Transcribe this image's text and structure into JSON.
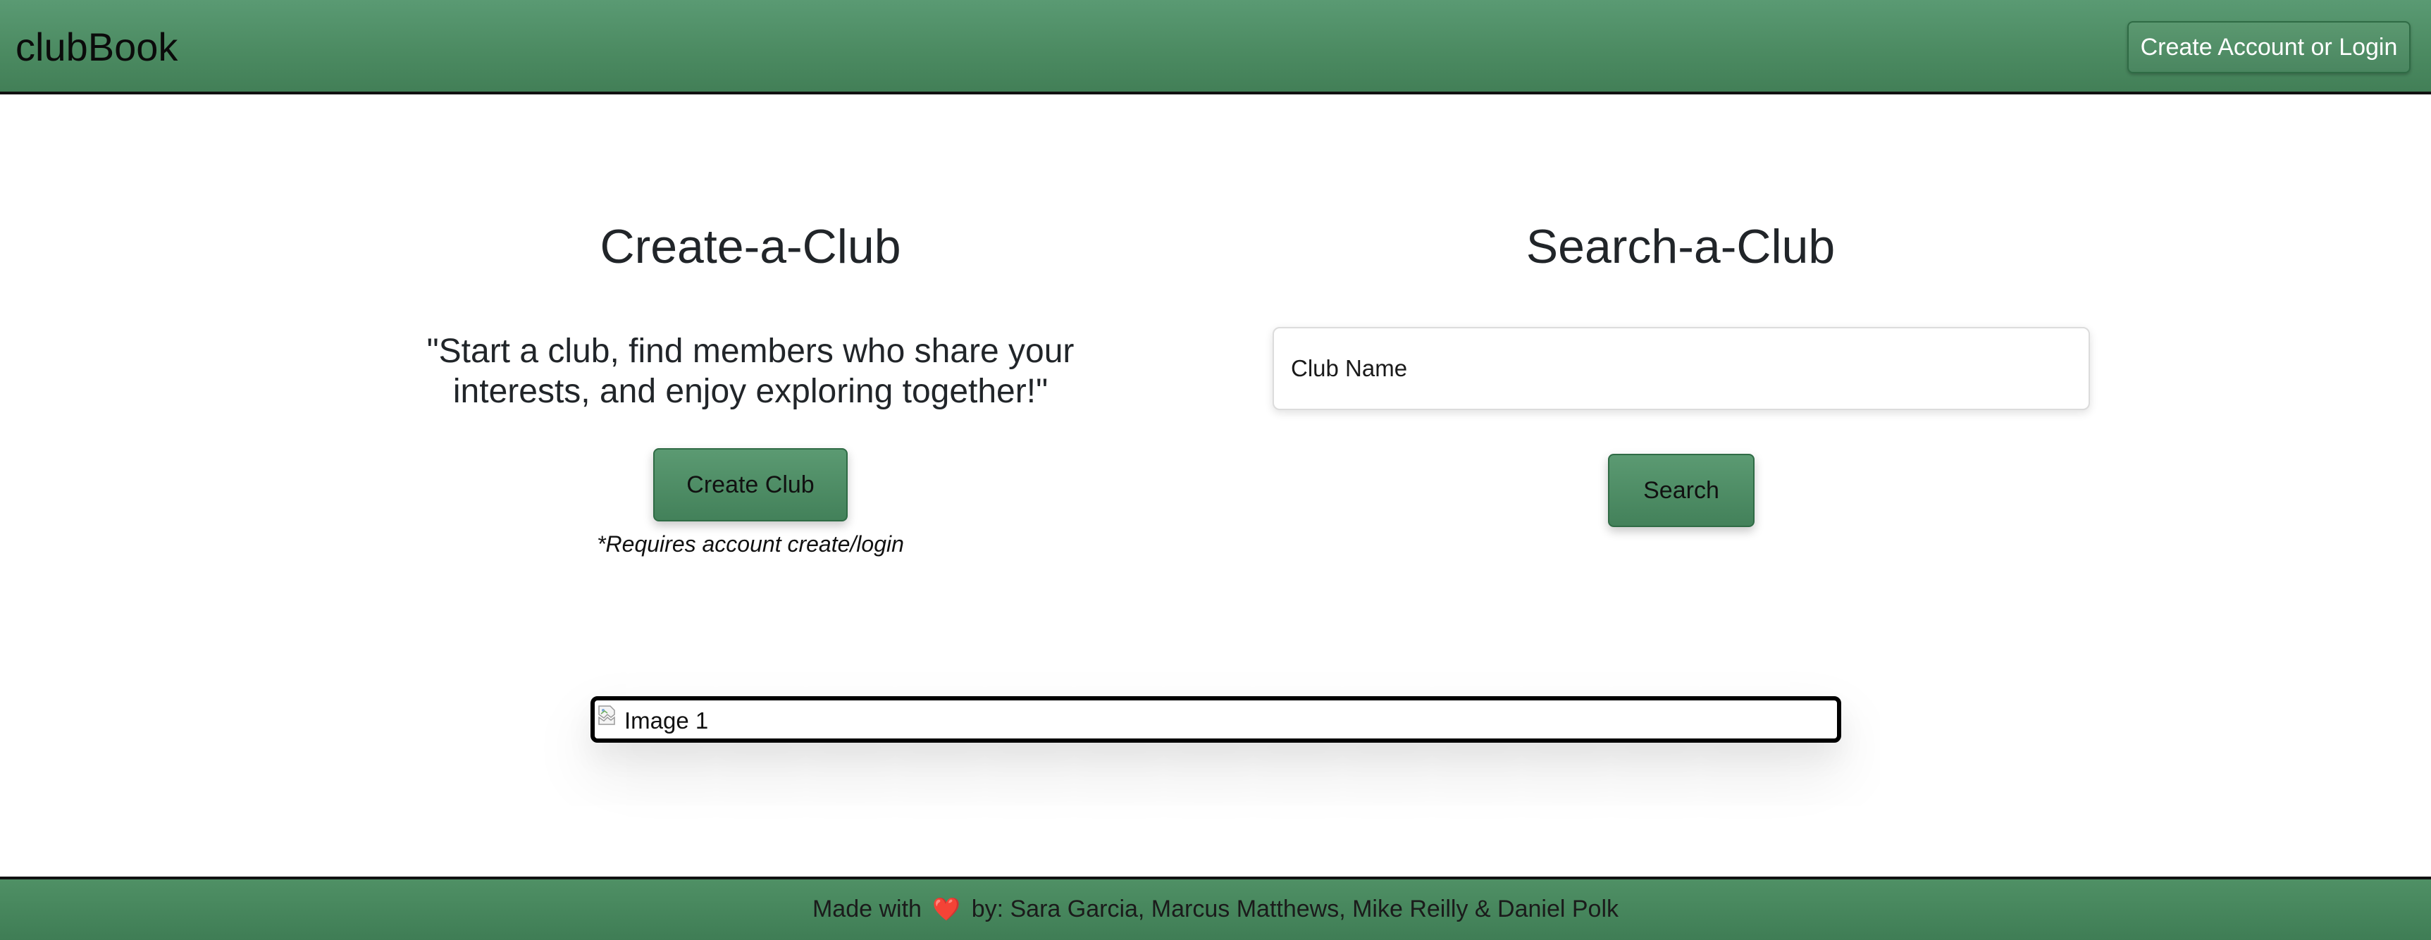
{
  "header": {
    "brand": "clubBook",
    "login_button": "Create Account or Login"
  },
  "create_section": {
    "title": "Create-a-Club",
    "tagline_line1": "\"Start a club, find members who share your",
    "tagline_line2": "interests, and enjoy exploring together!\"",
    "button_label": "Create Club",
    "note": "*Requires account create/login"
  },
  "search_section": {
    "title": "Search-a-Club",
    "input_placeholder": "Club Name",
    "input_value": "",
    "button_label": "Search"
  },
  "image": {
    "alt_text": "Image 1",
    "icon": "broken-image-icon"
  },
  "footer": {
    "prefix": "Made with",
    "heart_icon": "heart-icon",
    "heart_glyph": "❤️",
    "suffix": "by: Sara Garcia, Marcus Matthews, Mike Reilly & Daniel Polk"
  },
  "colors": {
    "header_green": "#4c8b62",
    "footer_green": "#4a8b60",
    "button_green": "#4f8e66",
    "heart": "#e0272f"
  }
}
